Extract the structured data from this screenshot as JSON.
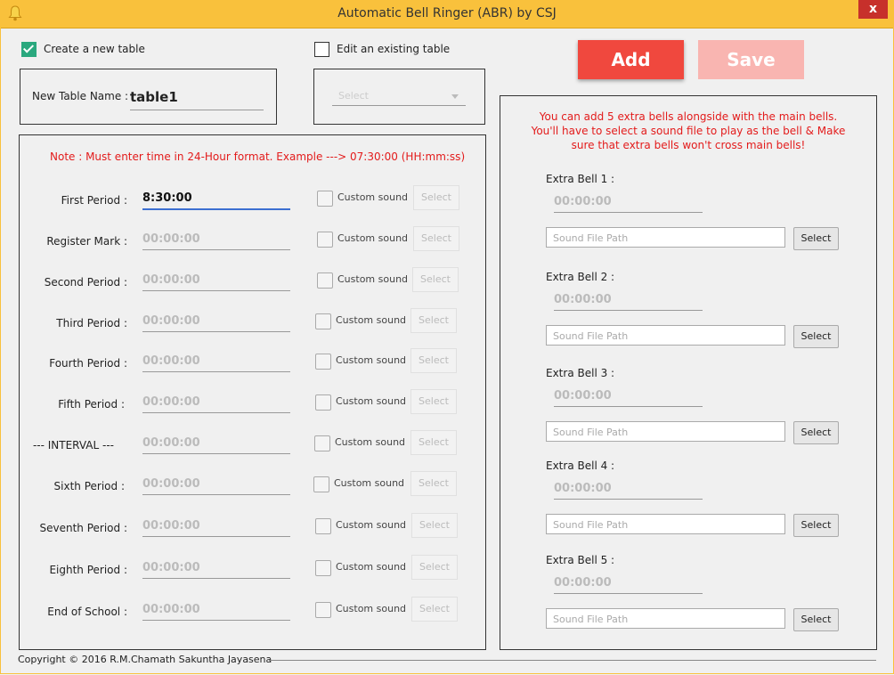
{
  "window": {
    "title": "Automatic Bell Ringer (ABR) by CSJ",
    "close_glyph": "x"
  },
  "mode": {
    "create_label": "Create a new table",
    "create_checked": true,
    "edit_label": "Edit an existing table",
    "edit_checked": false
  },
  "table_name": {
    "label": "New Table Name :",
    "value": "table1"
  },
  "existing_select": {
    "placeholder": "Select"
  },
  "buttons": {
    "add": "Add",
    "save": "Save"
  },
  "note": "Note :  Must enter time in 24-Hour format. Example --->  07:30:00 (HH:mm:ss)",
  "periods": [
    {
      "label": "First Period :",
      "time": "8:30:00"
    },
    {
      "label": "Register Mark :",
      "time": "00:00:00"
    },
    {
      "label": "Second Period :",
      "time": "00:00:00"
    },
    {
      "label": "Third Period :",
      "time": "00:00:00"
    },
    {
      "label": "Fourth Period :",
      "time": "00:00:00"
    },
    {
      "label": "Fifth Period :",
      "time": "00:00:00"
    },
    {
      "label": "--- INTERVAL ---",
      "time": "00:00:00"
    },
    {
      "label": "Sixth Period :",
      "time": "00:00:00"
    },
    {
      "label": "Seventh Period :",
      "time": "00:00:00"
    },
    {
      "label": "Eighth Period :",
      "time": "00:00:00"
    },
    {
      "label": "End of School :",
      "time": "00:00:00"
    }
  ],
  "custom_sound_label": "Custom sound",
  "select_label": "Select",
  "extra_info": "You can add 5 extra bells alongside with the main bells. You'll have to select a sound file to play as the bell & Make sure that extra bells won't cross main bells!",
  "extra_bells": [
    {
      "label": "Extra Bell 1 :",
      "time": "00:00:00",
      "path_placeholder": "Sound File Path",
      "button": "Select"
    },
    {
      "label": "Extra Bell 2 :",
      "time": "00:00:00",
      "path_placeholder": "Sound File Path",
      "button": "Select"
    },
    {
      "label": "Extra Bell 3 :",
      "time": "00:00:00",
      "path_placeholder": "Sound File Path",
      "button": "Select"
    },
    {
      "label": "Extra Bell 4 :",
      "time": "00:00:00",
      "path_placeholder": "Sound File Path",
      "button": "Select"
    },
    {
      "label": "Extra Bell 5 :",
      "time": "00:00:00",
      "path_placeholder": "Sound File Path",
      "button": "Select"
    }
  ],
  "footer": {
    "copyright": "Copyright © 2016 R.M.Chamath Sakuntha Jayasena"
  },
  "colors": {
    "titlebar": "#f9c13c",
    "accent_red": "#f0483e",
    "save_disabled": "#f9b5b1",
    "checkbox_green": "#2aa87e",
    "note_red": "#e31b1b"
  },
  "icons": {
    "app": "bell-icon",
    "check": "checkmark-icon",
    "dropdown": "caret-down-icon"
  }
}
